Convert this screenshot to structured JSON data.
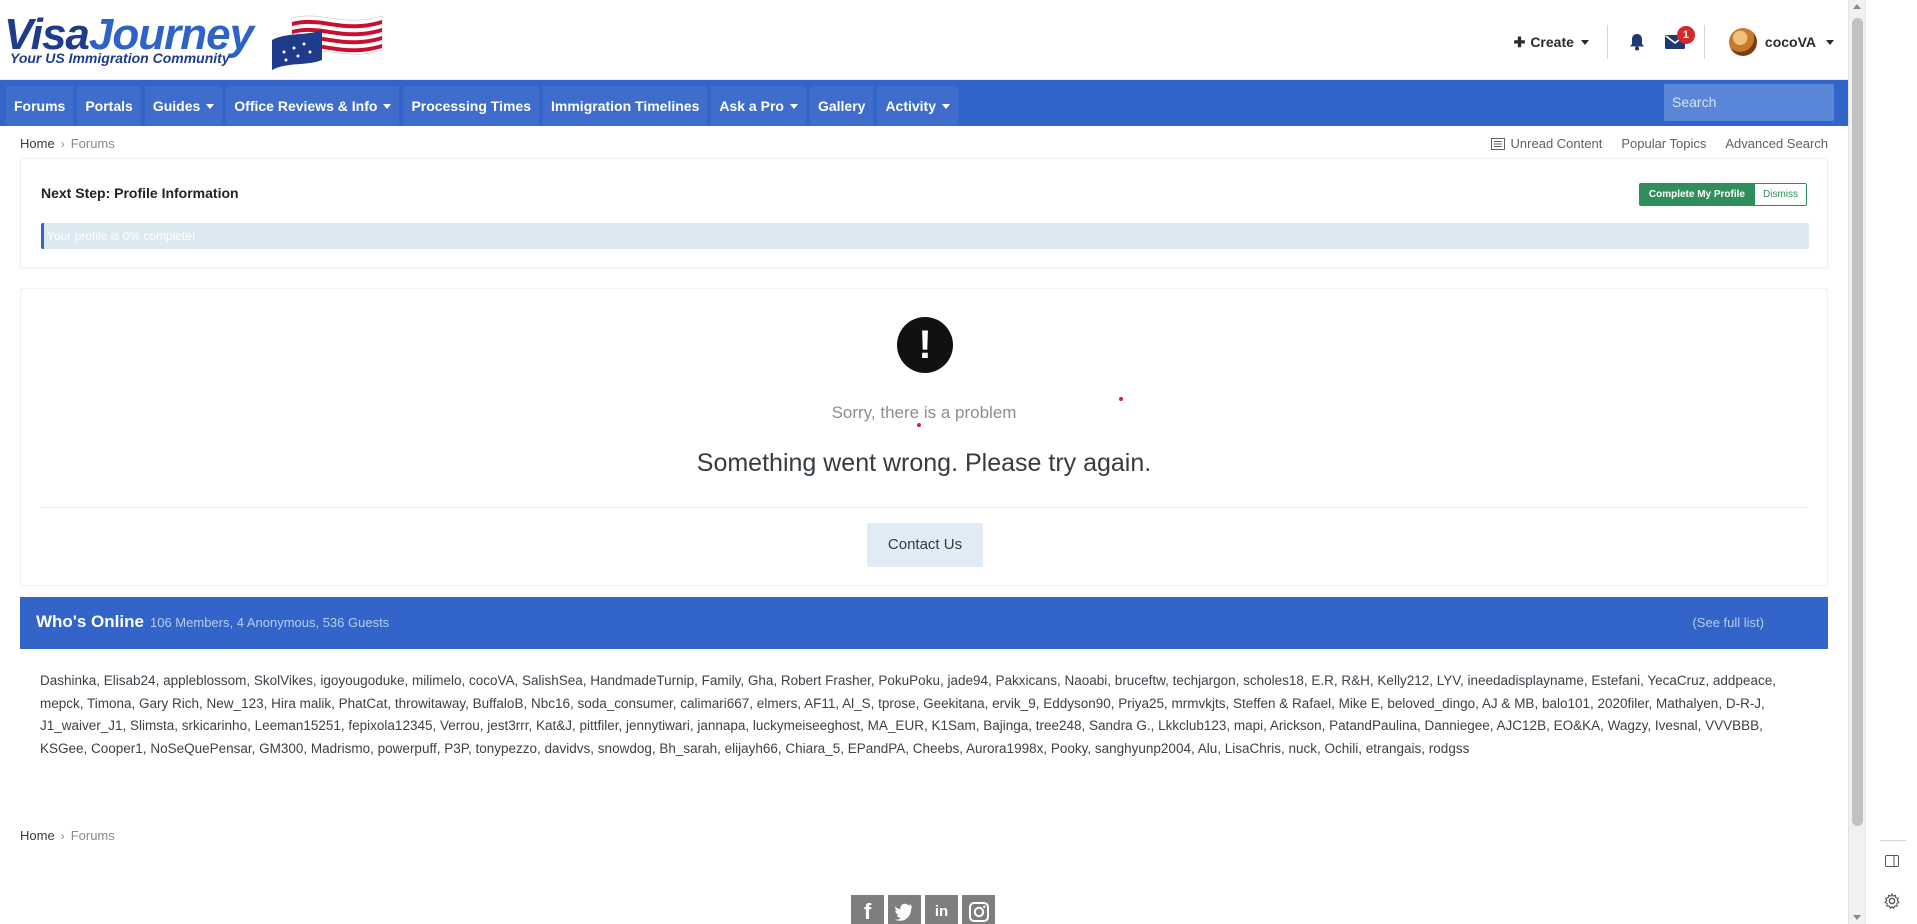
{
  "header": {
    "logo_main_1": "Visa",
    "logo_main_2": "Journey",
    "logo_tagline": "Your US Immigration Community",
    "create_label": "Create",
    "notifications_icon": "bell-icon",
    "messages_icon": "envelope-icon",
    "messages_badge": "1",
    "username": "cocoVA"
  },
  "nav": {
    "items": [
      {
        "label": "Forums",
        "dropdown": false
      },
      {
        "label": "Portals",
        "dropdown": false
      },
      {
        "label": "Guides",
        "dropdown": true
      },
      {
        "label": "Office Reviews & Info",
        "dropdown": true
      },
      {
        "label": "Processing Times",
        "dropdown": false
      },
      {
        "label": "Immigration Timelines",
        "dropdown": false
      },
      {
        "label": "Ask a Pro",
        "dropdown": true
      },
      {
        "label": "Gallery",
        "dropdown": false
      },
      {
        "label": "Activity",
        "dropdown": true
      }
    ],
    "search_placeholder": "Search"
  },
  "breadcrumb": {
    "home": "Home",
    "current": "Forums",
    "separator": "›"
  },
  "quick_links": {
    "unread": "Unread Content",
    "popular": "Popular Topics",
    "advanced": "Advanced Search"
  },
  "profile_step": {
    "title": "Next Step: Profile Information",
    "complete_label": "Complete My Profile",
    "dismiss_label": "Dismiss",
    "progress_text": "Your profile is 0% complete!",
    "progress_value": 0
  },
  "error": {
    "icon": "exclamation-icon",
    "subtitle": "Sorry, there is a problem",
    "message": "Something went wrong. Please try again.",
    "contact_label": "Contact Us"
  },
  "whos_online": {
    "title": "Who's Online",
    "counts": "106 Members, 4 Anonymous, 536 Guests",
    "full_list_label": "(See full list)",
    "members": "Dashinka, Elisab24, appleblossom, SkolVikes, igoyougoduke, milimelo, cocoVA, SalishSea, HandmadeTurnip, Family, Gha, Robert Frasher, PokuPoku, jade94, Pakxicans, Naoabi, bruceftw, techjargon, scholes18, E.R, R&H, Kelly212, LYV, ineedadisplayname, Estefani, YecaCruz, addpeace, mepck, Timona, Gary Rich, New_123, Hira malik, PhatCat, throwitaway, BuffaloB, Nbc16, soda_consumer, calimari667, elmers, AF11, Al_S, tprose, Geekitana, ervik_9, Eddyson90, Priya25, mrmvkjts, Steffen & Rafael, Mike E, beloved_dingo, AJ & MB, balo101, 2020filer, Mathalyen, D-R-J, J1_waiver_J1, Slimsta, srkicarinho, Leeman15251, fepixola12345, Verrou, jest3rrr, Kat&J, pittfiler, jennytiwari, jannapa, luckymeiseeghost, MA_EUR, K1Sam, Bajinga, tree248, Sandra G., Lkkclub123, mapi, Arickson, PatandPaulina, Danniegee, AJC12B, EO&KA, Wagzy, Ivesnal, VVVBBB, KSGee, Cooper1, NoSeQuePensar, GM300, Madrismo, powerpuff, P3P, tonypezzo, davidvs, snowdog, Bh_sarah, elijayh66, Chiara_5, EPandPA, Cheebs, Aurora1998x, Pooky, sanghyunp2004, Alu, LisaChris, nuck, Ochili, etrangais, rodgss"
  },
  "footer": {
    "social": [
      "facebook-icon",
      "twitter-icon",
      "linkedin-icon",
      "instagram-icon"
    ]
  },
  "colors": {
    "nav_blue": "#3264c9",
    "complete_green": "#2f8e5b",
    "badge_red": "#d62828",
    "contact_bg": "#e0ebf5"
  }
}
